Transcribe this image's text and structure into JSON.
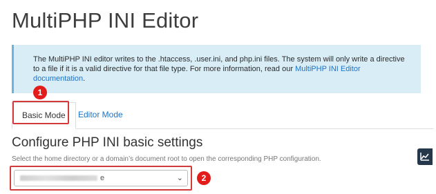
{
  "page": {
    "title": "MultiPHP INI Editor"
  },
  "info": {
    "text": "The MultiPHP INI editor writes to the .htaccess, .user.ini, and php.ini files. The system will only write a directive to a file if it is a valid directive for that file type. For more information, read our ",
    "link": "MultiPHP INI Editor documentation",
    "suffix": "."
  },
  "tabs": [
    {
      "label": "Basic Mode"
    },
    {
      "label": "Editor Mode"
    }
  ],
  "section": {
    "title": "Configure PHP INI basic settings",
    "helper": "Select the home directory or a domain’s document root to open the corresponding PHP configuration."
  },
  "select": {
    "value_tail": "e"
  },
  "annotations": [
    "1",
    "2"
  ],
  "icons": {
    "dropdown": "chevron-down-icon",
    "side_widget": "chart-line-icon"
  },
  "colors": {
    "highlight": "#d33b3b",
    "badge": "#e21b1b",
    "link": "#1a73c6",
    "info_bg": "#d9edf7"
  }
}
